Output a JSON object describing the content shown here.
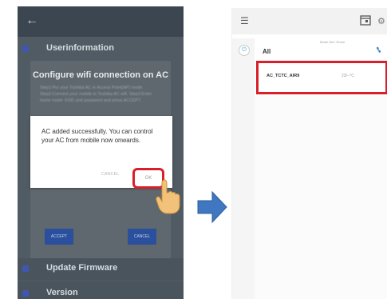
{
  "left_screen": {
    "menu_user_info": "Userinformation",
    "config_dialog": {
      "title": "Configure wifi connection on AC",
      "body": "Step1:Put your Toshiba AC in Access Point(AP) mode. Step2:Connect your mobile to Toshiba AC wifi. Step3:Enter home router SSID and password and press ACCEPT.",
      "accept_label": "ACCEPT",
      "cancel_label": "CANCEL"
    },
    "success_dialog": {
      "message": "AC added successfully. You can control your AC from mobile now onwards.",
      "cancel_label": "CANCEL",
      "ok_label": "OK"
    },
    "menu_update_firmware": "Update Firmware",
    "menu_version": "Version"
  },
  "right_screen": {
    "group_label": "All",
    "column_headers": "Mode  Set / Room",
    "ac_list": [
      {
        "name": "AC_TCTC_AIR9",
        "temp": "23/--°C"
      }
    ]
  },
  "colors": {
    "highlight": "#d8202a",
    "arrow": "#3f77c0",
    "dark_overlay": "#505b63"
  }
}
